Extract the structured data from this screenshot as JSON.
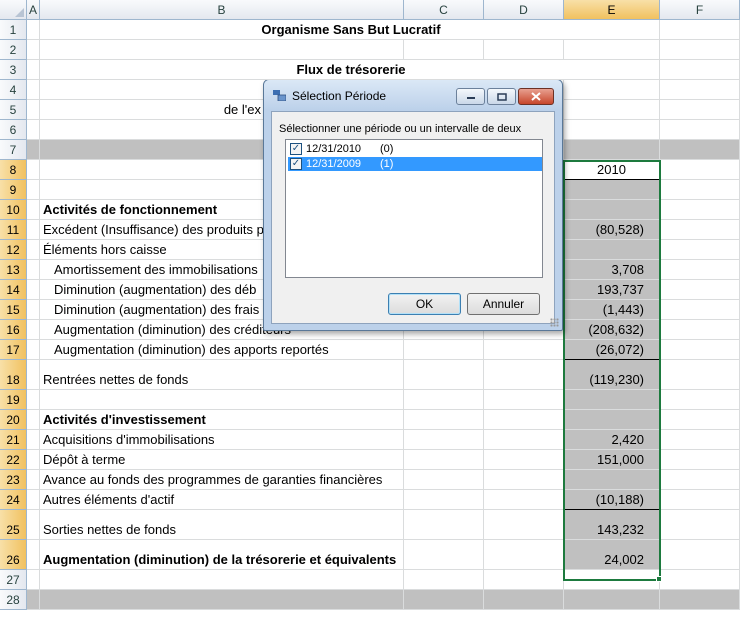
{
  "columns": [
    "A",
    "B",
    "C",
    "D",
    "E",
    "F"
  ],
  "rows": [
    {
      "n": "1",
      "b": "Organisme Sans But Lucratif",
      "e": "",
      "bold": true,
      "center": true
    },
    {
      "n": "2",
      "b": "",
      "e": ""
    },
    {
      "n": "3",
      "b": "Flux de trésorerie",
      "e": "",
      "bold": true,
      "center": true
    },
    {
      "n": "4",
      "b": "",
      "e": ""
    },
    {
      "n": "5",
      "b": "de l'ex",
      "e": ""
    },
    {
      "n": "6",
      "b": "",
      "e": ""
    },
    {
      "n": "7",
      "b": "",
      "e": "",
      "gray": true
    },
    {
      "n": "8",
      "b": "",
      "e": "2010"
    },
    {
      "n": "9",
      "b": "",
      "e": ""
    },
    {
      "n": "10",
      "b": "Activités de fonctionnement",
      "e": "",
      "bold": true
    },
    {
      "n": "11",
      "b": "Excédent (Insuffisance) des produits p",
      "e": "(80,528)"
    },
    {
      "n": "12",
      "b": "Éléments hors caisse",
      "e": ""
    },
    {
      "n": "13",
      "b": "Amortissement des immobilisations",
      "e": "3,708",
      "indent": true
    },
    {
      "n": "14",
      "b": "Diminution (augmentation) des déb",
      "e": "193,737",
      "indent": true
    },
    {
      "n": "15",
      "b": "Diminution (augmentation) des frais",
      "e": "(1,443)",
      "indent": true
    },
    {
      "n": "16",
      "b": "Augmentation (diminution) des créditeurs",
      "e": "(208,632)",
      "indent": true
    },
    {
      "n": "17",
      "b": "Augmentation (diminution) des apports reportés",
      "e": "(26,072)",
      "indent": true
    },
    {
      "n": "18",
      "b": "Rentrées nettes de fonds",
      "e": "(119,230)"
    },
    {
      "n": "19",
      "b": "",
      "e": ""
    },
    {
      "n": "20",
      "b": "Activités d'investissement",
      "e": "",
      "bold": true
    },
    {
      "n": "21",
      "b": "Acquisitions d'immobilisations",
      "e": "2,420"
    },
    {
      "n": "22",
      "b": "Dépôt à terme",
      "e": "151,000"
    },
    {
      "n": "23",
      "b": "Avance au fonds des programmes de garanties financières",
      "e": ""
    },
    {
      "n": "24",
      "b": "Autres éléments d'actif",
      "e": "(10,188)"
    },
    {
      "n": "25",
      "b": "Sorties nettes de fonds",
      "e": "143,232"
    },
    {
      "n": "26",
      "b": "Augmentation (diminution) de la trésorerie et équivalents",
      "e": "24,002",
      "bold": true
    },
    {
      "n": "27",
      "b": "",
      "e": ""
    },
    {
      "n": "28",
      "b": "",
      "e": "",
      "gray": true
    }
  ],
  "dialog": {
    "title": "Sélection Période",
    "label": "Sélectionner une période ou un intervalle de deux",
    "items": [
      {
        "date": "12/31/2010",
        "index": "(0)",
        "checked": true,
        "highlighted": false
      },
      {
        "date": "12/31/2009",
        "index": "(1)",
        "checked": true,
        "highlighted": true
      }
    ],
    "ok_label": "OK",
    "cancel_label": "Annuler"
  },
  "colors": {
    "selection_border": "#1d7a3e",
    "highlight": "#3399ff",
    "gray_band": "#c0c0c0"
  }
}
